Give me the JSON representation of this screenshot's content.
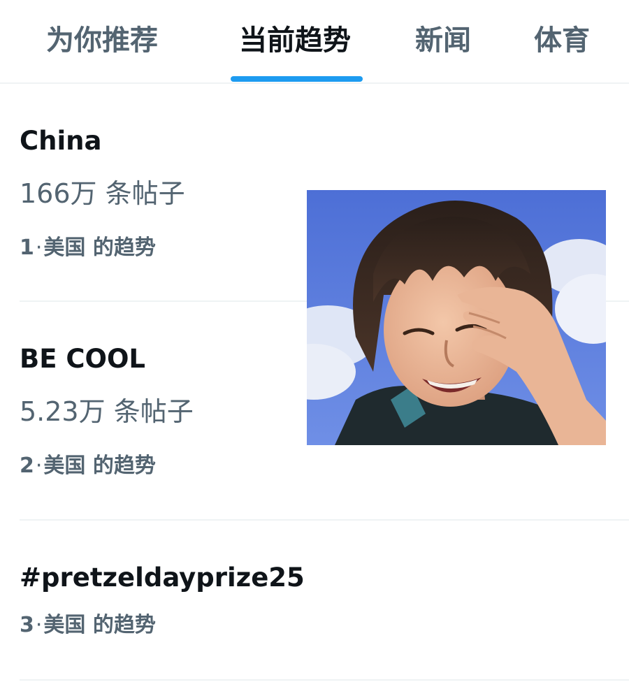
{
  "tabs": [
    {
      "label": "为你推荐",
      "active": false
    },
    {
      "label": "当前趋势",
      "active": true
    },
    {
      "label": "新闻",
      "active": false
    },
    {
      "label": "体育",
      "active": false
    }
  ],
  "accent_color": "#1d9bf0",
  "trends": [
    {
      "title": "China",
      "count": "166万 条帖子",
      "rank": "1",
      "region": "美国 的趋势"
    },
    {
      "title": "BE COOL",
      "count": "5.23万 条帖子",
      "rank": "2",
      "region": "美国 的趋势"
    },
    {
      "title": "#pretzeldayprize25",
      "rank": "3",
      "region": "美国 的趋势"
    }
  ],
  "separator": "·"
}
